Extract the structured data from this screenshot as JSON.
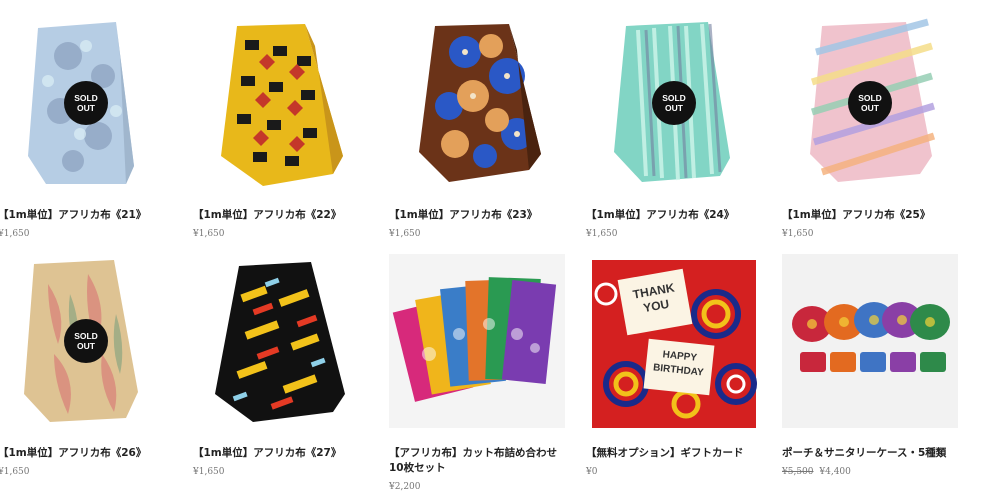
{
  "products": [
    {
      "title": "【1m単位】アフリカ布《21》",
      "price": "¥1,650",
      "sold_out": true
    },
    {
      "title": "【1m単位】アフリカ布《22》",
      "price": "¥1,650",
      "sold_out": false
    },
    {
      "title": "【1m単位】アフリカ布《23》",
      "price": "¥1,650",
      "sold_out": false
    },
    {
      "title": "【1m単位】アフリカ布《24》",
      "price": "¥1,650",
      "sold_out": true
    },
    {
      "title": "【1m単位】アフリカ布《25》",
      "price": "¥1,650",
      "sold_out": true
    },
    {
      "title": "【1m単位】アフリカ布《26》",
      "price": "¥1,650",
      "sold_out": true
    },
    {
      "title": "【1m単位】アフリカ布《27》",
      "price": "¥1,650",
      "sold_out": false
    },
    {
      "title": "【アフリカ布】カット布詰め合わせ10枚セット",
      "price": "¥2,200",
      "sold_out": false
    },
    {
      "title": "【無料オプション】ギフトカード",
      "price": "¥0",
      "sold_out": false
    },
    {
      "title": "ポーチ＆サニタリーケース・5種類",
      "price": "¥4,400",
      "original_price": "¥5,500",
      "sold_out": false
    }
  ],
  "sold_out_badge": "SOLD\nOUT",
  "gift_card_text": {
    "thank": "THANK",
    "you": "YOU",
    "happy": "HAPPY",
    "birthday": "BIRTHDAY"
  }
}
